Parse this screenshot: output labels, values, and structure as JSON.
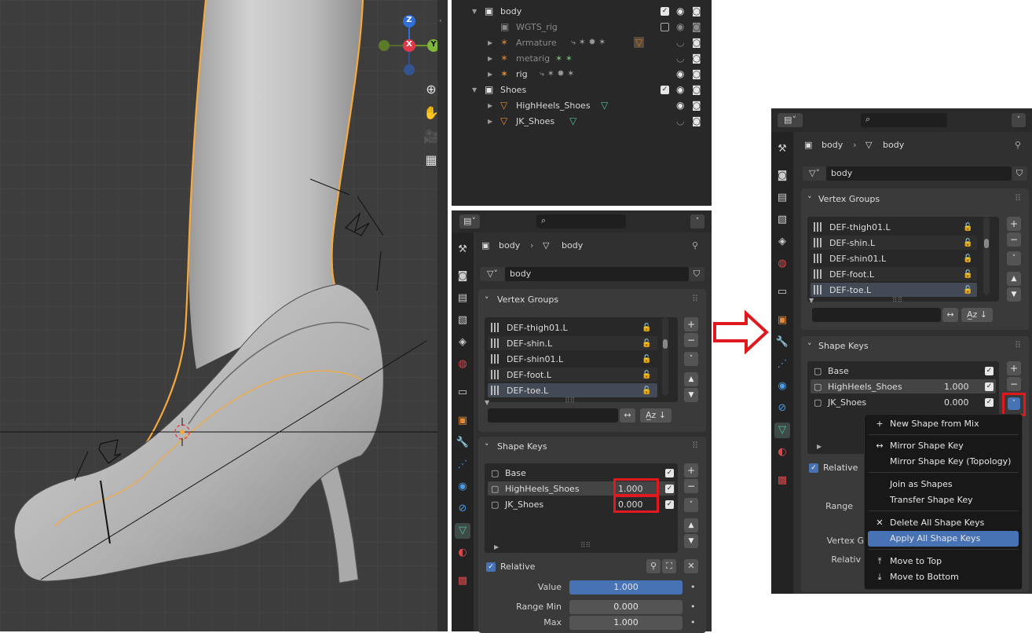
{
  "viewport": {
    "gizmo": {
      "z": "Z",
      "x": "X",
      "y": "Y"
    },
    "tools": [
      "zoom-icon",
      "hand-icon",
      "camera-icon",
      "grid-icon"
    ]
  },
  "outliner": {
    "rows": [
      {
        "label": "body",
        "icon": "collection-icon"
      },
      {
        "label": "WGTS_rig",
        "icon": "collection-icon"
      },
      {
        "label": "Armature",
        "icon": "armature-icon"
      },
      {
        "label": "metarig",
        "icon": "armature-icon"
      },
      {
        "label": "rig",
        "icon": "armature-icon"
      },
      {
        "label": "Shoes",
        "icon": "collection-icon"
      },
      {
        "label": "HighHeels_Shoes",
        "icon": "mesh-icon"
      },
      {
        "label": "JK_Shoes",
        "icon": "mesh-icon"
      }
    ]
  },
  "props_left": {
    "breadcrumb": {
      "object": "body",
      "mesh": "body"
    },
    "mesh_name": "body",
    "vertex_groups": {
      "title": "Vertex Groups",
      "items": [
        "DEF-thigh01.L",
        "DEF-shin.L",
        "DEF-shin01.L",
        "DEF-foot.L",
        "DEF-toe.L"
      ]
    },
    "shape_keys": {
      "title": "Shape Keys",
      "items": [
        {
          "name": "Base",
          "value": ""
        },
        {
          "name": "HighHeels_Shoes",
          "value": "1.000"
        },
        {
          "name": "JK_Shoes",
          "value": "0.000"
        }
      ]
    },
    "relative_label": "Relative",
    "value_label": "Value",
    "value": "1.000",
    "range_min_label": "Range Min",
    "range_min": "0.000",
    "max_label": "Max",
    "max": "1.000"
  },
  "props_right": {
    "breadcrumb": {
      "object": "body",
      "mesh": "body"
    },
    "mesh_name": "body",
    "vertex_groups": {
      "title": "Vertex Groups",
      "items": [
        "DEF-thigh01.L",
        "DEF-shin.L",
        "DEF-shin01.L",
        "DEF-foot.L",
        "DEF-toe.L"
      ]
    },
    "shape_keys": {
      "title": "Shape Keys",
      "items": [
        {
          "name": "Base",
          "value": ""
        },
        {
          "name": "HighHeels_Shoes",
          "value": "1.000"
        },
        {
          "name": "JK_Shoes",
          "value": "0.000"
        }
      ]
    },
    "relative_label": "Relative",
    "partial_labels": {
      "value": "V",
      "range": "Range",
      "vertex": "Vertex G",
      "relative": "Relativ"
    }
  },
  "context_menu": {
    "items": [
      {
        "label": "New Shape from Mix",
        "icon": "plus-icon"
      },
      {
        "label": "Mirror Shape Key",
        "icon": "arrows-icon"
      },
      {
        "label": "Mirror Shape Key (Topology)",
        "icon": ""
      },
      {
        "label": "Join as Shapes",
        "icon": ""
      },
      {
        "label": "Transfer Shape Key",
        "icon": ""
      },
      {
        "label": "Delete All Shape Keys",
        "icon": "x-icon"
      },
      {
        "label": "Apply All Shape Keys",
        "icon": ""
      },
      {
        "label": "Move to Top",
        "icon": "move-top-icon"
      },
      {
        "label": "Move to Bottom",
        "icon": "move-bottom-icon"
      }
    ],
    "highlighted": "Apply All Shape Keys"
  },
  "colors": {
    "accent": "#4772b3",
    "annotation_red": "#e0191f",
    "selection_orange": "#f5a93e"
  }
}
